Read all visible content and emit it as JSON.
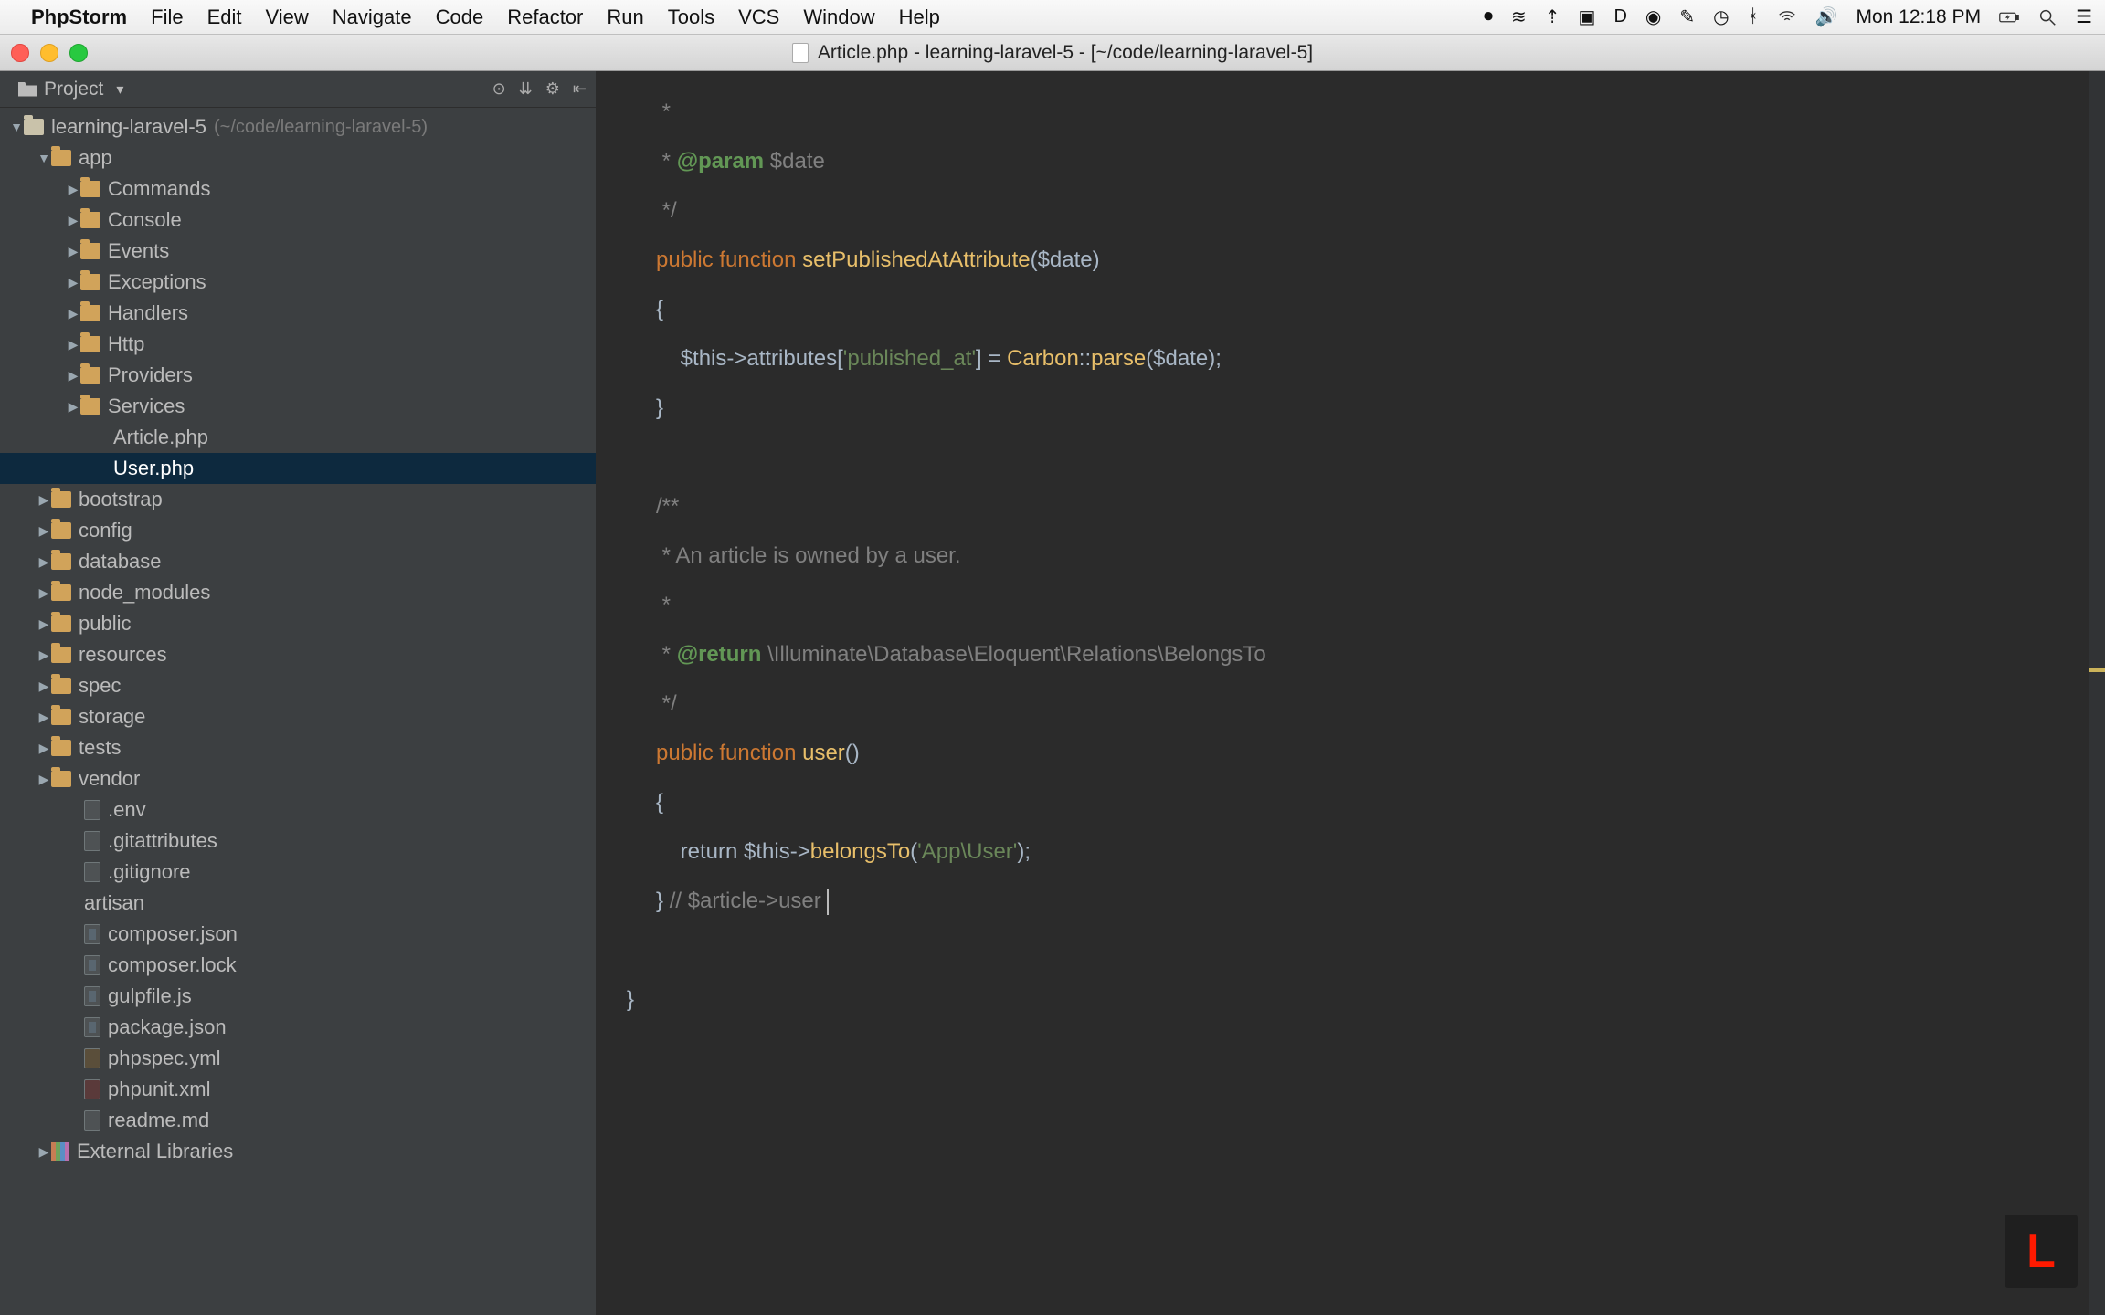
{
  "menubar": {
    "app": "PhpStorm",
    "items": [
      "File",
      "Edit",
      "View",
      "Navigate",
      "Code",
      "Refactor",
      "Run",
      "Tools",
      "VCS",
      "Window",
      "Help"
    ],
    "clock": "Mon 12:18 PM"
  },
  "window": {
    "title": "Article.php - learning-laravel-5 - [~/code/learning-laravel-5]"
  },
  "sidebar": {
    "tool_label": "Project",
    "root": {
      "name": "learning-laravel-5",
      "hint": "(~/code/learning-laravel-5)"
    },
    "app": {
      "name": "app",
      "folders": [
        "Commands",
        "Console",
        "Events",
        "Exceptions",
        "Handlers",
        "Http",
        "Providers",
        "Services"
      ],
      "files": [
        "Article.php",
        "User.php"
      ]
    },
    "top_folders": [
      "bootstrap",
      "config",
      "database",
      "node_modules",
      "public",
      "resources",
      "spec",
      "storage",
      "tests",
      "vendor"
    ],
    "root_files": [
      {
        "name": ".env",
        "type": "file"
      },
      {
        "name": ".gitattributes",
        "type": "file"
      },
      {
        "name": ".gitignore",
        "type": "file"
      },
      {
        "name": "artisan",
        "type": "plain"
      },
      {
        "name": "composer.json",
        "type": "json"
      },
      {
        "name": "composer.lock",
        "type": "json"
      },
      {
        "name": "gulpfile.js",
        "type": "json"
      },
      {
        "name": "package.json",
        "type": "json"
      },
      {
        "name": "phpspec.yml",
        "type": "yml"
      },
      {
        "name": "phpunit.xml",
        "type": "xml"
      },
      {
        "name": "readme.md",
        "type": "file"
      }
    ],
    "external": "External Libraries",
    "selected_file": "User.php"
  },
  "code": {
    "l1": " *",
    "l2_pre": " * ",
    "l2_tag": "@param",
    "l2_var": " $date",
    "l3": " */",
    "l4_kw": "public function ",
    "l4_fn": "setPublishedAtAttribute",
    "l4_rest": "($date)",
    "l5": "{",
    "l6_a": "    $this->attributes[",
    "l6_str": "'published_at'",
    "l6_b": "] = ",
    "l6_cls": "Carbon",
    "l6_sep": "::",
    "l6_m": "parse",
    "l6_c": "($date);",
    "l7": "}",
    "l8": "/**",
    "l9": " * An article is owned by a user.",
    "l10": " *",
    "l11_a": " * ",
    "l11_tag": "@return",
    "l11_b": " \\Illuminate\\Database\\Eloquent\\Relations\\BelongsTo",
    "l12": " */",
    "l13_kw": "public function ",
    "l13_fn": "user",
    "l13_rest": "()",
    "l14": "{",
    "l15_a": "    return $this->",
    "l15_m": "belongsTo",
    "l15_b": "(",
    "l15_str": "'App\\User'",
    "l15_c": ");",
    "l16_a": "} ",
    "l16_comm": "// $article->user",
    "l17": "}"
  },
  "badge": "L"
}
